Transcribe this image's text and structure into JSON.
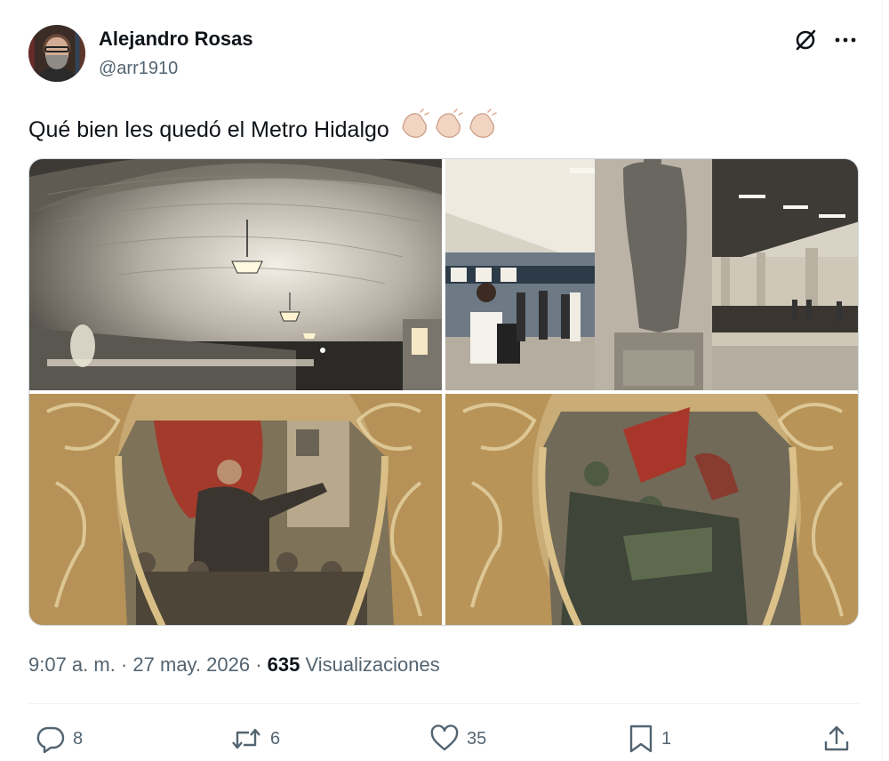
{
  "author": {
    "name": "Alejandro Rosas",
    "handle": "@arr1910"
  },
  "tweet": {
    "text": "Qué bien les quedó el Metro Hidalgo",
    "emoji": "👏🏻👏🏻👏🏻"
  },
  "media": [
    {
      "name": "vaulted-ceiling-photo"
    },
    {
      "name": "platform-statue-photo"
    },
    {
      "name": "mosaic-red-banner-photo"
    },
    {
      "name": "mosaic-soldiers-photo"
    }
  ],
  "meta": {
    "time": "9:07 a. m.",
    "sep1": " · ",
    "date": "27 may. 2026",
    "sep2": " · ",
    "views_count": "635",
    "views_label": " Visualizaciones"
  },
  "actions": {
    "reply_count": "8",
    "retweet_count": "6",
    "like_count": "35",
    "bookmark_count": "1"
  },
  "colors": {
    "text_primary": "#0f1419",
    "text_secondary": "#536471",
    "border": "#cfd9de",
    "divider": "#eff3f4"
  },
  "icons": [
    "grok-icon",
    "more-icon",
    "reply-icon",
    "retweet-icon",
    "like-icon",
    "bookmark-icon",
    "share-icon"
  ]
}
